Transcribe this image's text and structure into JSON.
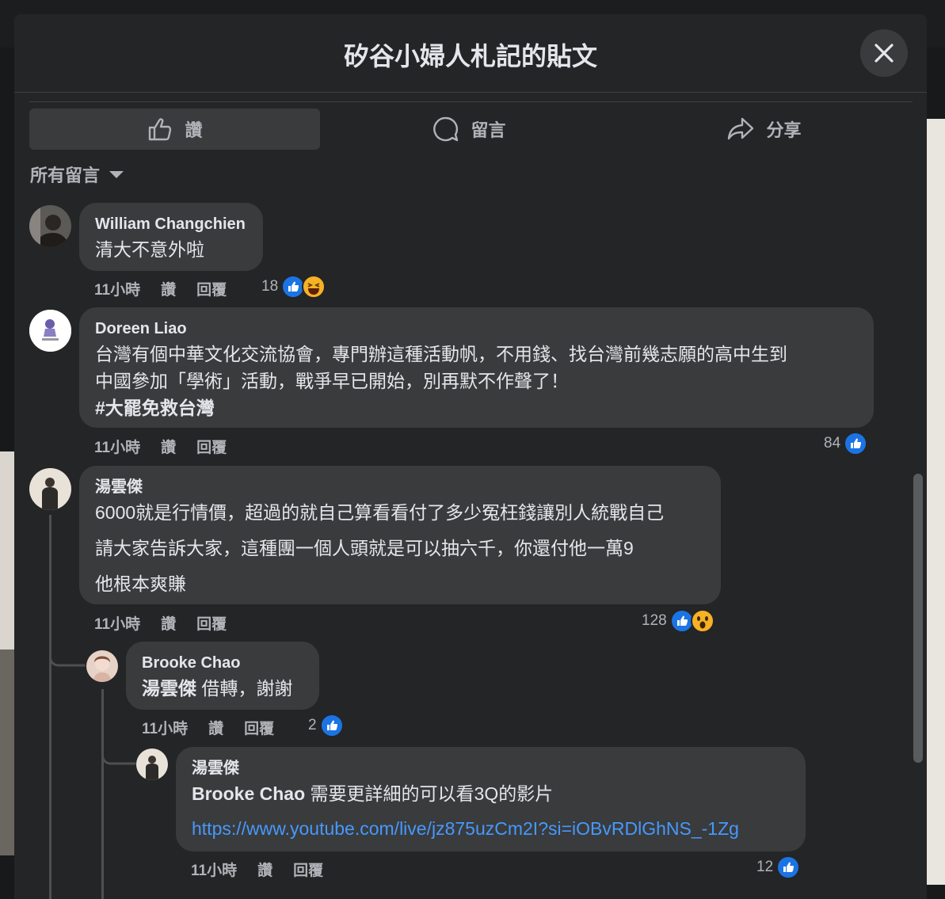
{
  "dialog": {
    "title": "矽谷小婦人札記的貼文",
    "actions": {
      "like": "讚",
      "comment": "留言",
      "share": "分享"
    },
    "filter": "所有留言"
  },
  "comments": [
    {
      "author": "William Changchien",
      "text": "清大不意外啦",
      "time": "11小時",
      "like": "讚",
      "reply": "回覆",
      "reactions": "18",
      "reaction_types": [
        "like-icon",
        "laugh-emoji"
      ]
    },
    {
      "author": "Doreen Liao",
      "lines": [
        "台灣有個中華文化交流協會，專門辦這種活動帆，不用錢、找台灣前幾志願的高中生到",
        "中國參加「學術」活動，戰爭早已開始，別再默不作聲了！"
      ],
      "hashtag": "#大罷免救台灣",
      "time": "11小時",
      "like": "讚",
      "reply": "回覆",
      "reactions": "84",
      "reaction_types": [
        "like-icon"
      ]
    },
    {
      "author": "湯雲傑",
      "lines": [
        "6000就是行情價，超過的就自己算看看付了多少冤枉錢讓別人統戰自己",
        "請大家告訴大家，這種團一個人頭就是可以抽六千，你還付他一萬9",
        "他根本爽賺"
      ],
      "time": "11小時",
      "like": "讚",
      "reply": "回覆",
      "reactions": "128",
      "reaction_types": [
        "like-icon",
        "wow-emoji"
      ]
    }
  ],
  "replies": [
    {
      "author": "Brooke Chao",
      "mention": "湯雲傑",
      "text": " 借轉，謝謝",
      "time": "11小時",
      "like": "讚",
      "reply": "回覆",
      "reactions": "2"
    },
    {
      "author": "湯雲傑",
      "mention": "Brooke Chao",
      "text": " 需要更詳細的可以看3Q的影片",
      "link": "https://www.youtube.com/live/jz875uzCm2I?si=iOBvRDlGhNS_-1Zg",
      "time": "11小時",
      "like": "讚",
      "reply": "回覆",
      "reactions": "12"
    }
  ],
  "colors": {
    "panel": "#242526",
    "bubble": "#3a3b3c",
    "accent": "#1b74e4",
    "link": "#4599ff"
  }
}
